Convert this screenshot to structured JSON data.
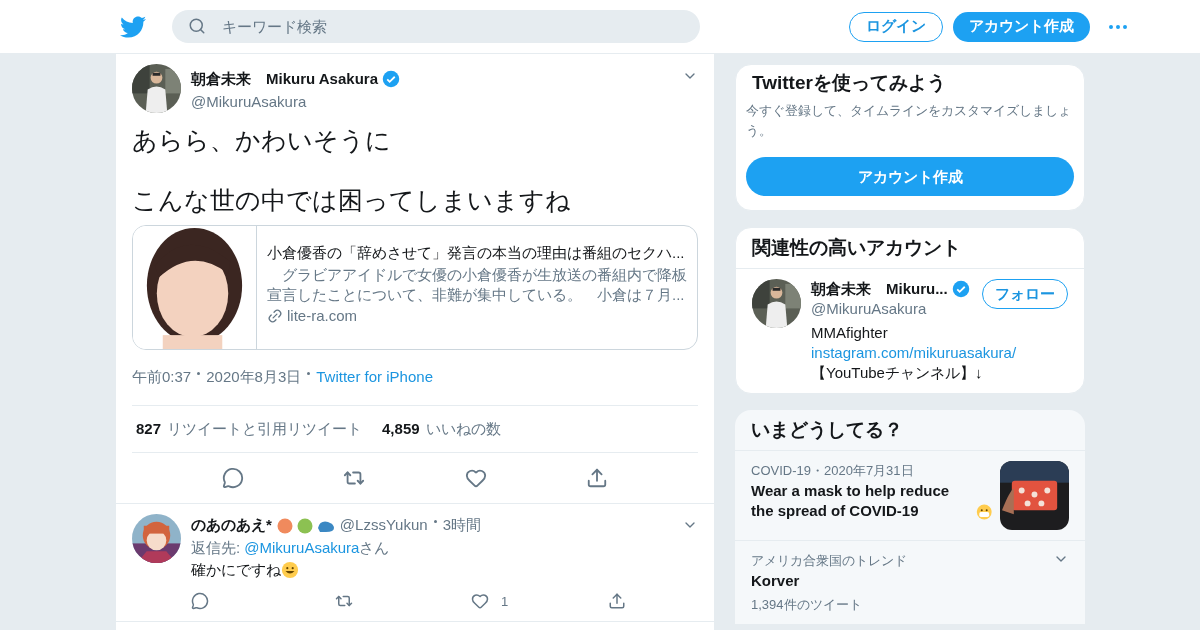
{
  "header": {
    "search_placeholder": "キーワード検索",
    "login": "ログイン",
    "signup": "アカウント作成"
  },
  "tweet": {
    "name": "朝倉未来　Mikuru Asakura",
    "verified": true,
    "handle": "@MikuruAsakura",
    "text_lines": [
      "あらら、かわいそうに",
      "こんな世の中では困ってしまいますね"
    ],
    "card": {
      "title": "小倉優香の「辞めさせて」発言の本当の理由は番組のセクハ...",
      "description": "　グラビアアイドルで女優の小倉優香が生放送の番組内で降板宣言したことについて、非難が集中している。　小倉は７月...",
      "domain": "lite-ra.com"
    },
    "time": "午前0:37",
    "date": "2020年8月3日",
    "source": "Twitter for iPhone",
    "retweets_count": "827",
    "retweets_label": "リツイートと引用リツイート",
    "likes_count": "4,859",
    "likes_label": "いいねの数"
  },
  "replies": [
    {
      "name": "のあのあえ*",
      "handle": "@LzssYukun",
      "time": "3時間",
      "reply_to_label": "返信先:",
      "reply_to_handle": "@MikuruAsakura",
      "reply_to_suffix": "さん",
      "text": "確かにですね",
      "like_count": "1"
    }
  ],
  "sidebar": {
    "signup_card": {
      "title": "Twitterを使ってみよう",
      "text": "今すぐ登録して、タイムラインをカスタマイズしましょう。",
      "button": "アカウント作成"
    },
    "related": {
      "title": "関連性の高いアカウント",
      "accounts": [
        {
          "name": "朝倉未来　Mikuru...",
          "verified": true,
          "handle": "@MikuruAsakura",
          "follow": "フォロー",
          "bio": "MMAfighter",
          "link": "instagram.com/mikuruasakura/",
          "bio_more": "【YouTubeチャンネル】↓"
        }
      ]
    },
    "trends": {
      "title": "いまどうしてる？",
      "items": [
        {
          "kind": "news",
          "meta": "COVID-19・2020年7月31日",
          "text": "Wear a mask to help reduce the spread of COVID-19"
        },
        {
          "kind": "trend",
          "context": "アメリカ合衆国のトレンド",
          "name": "Korver",
          "count": "1,394件のツイート"
        }
      ]
    }
  }
}
